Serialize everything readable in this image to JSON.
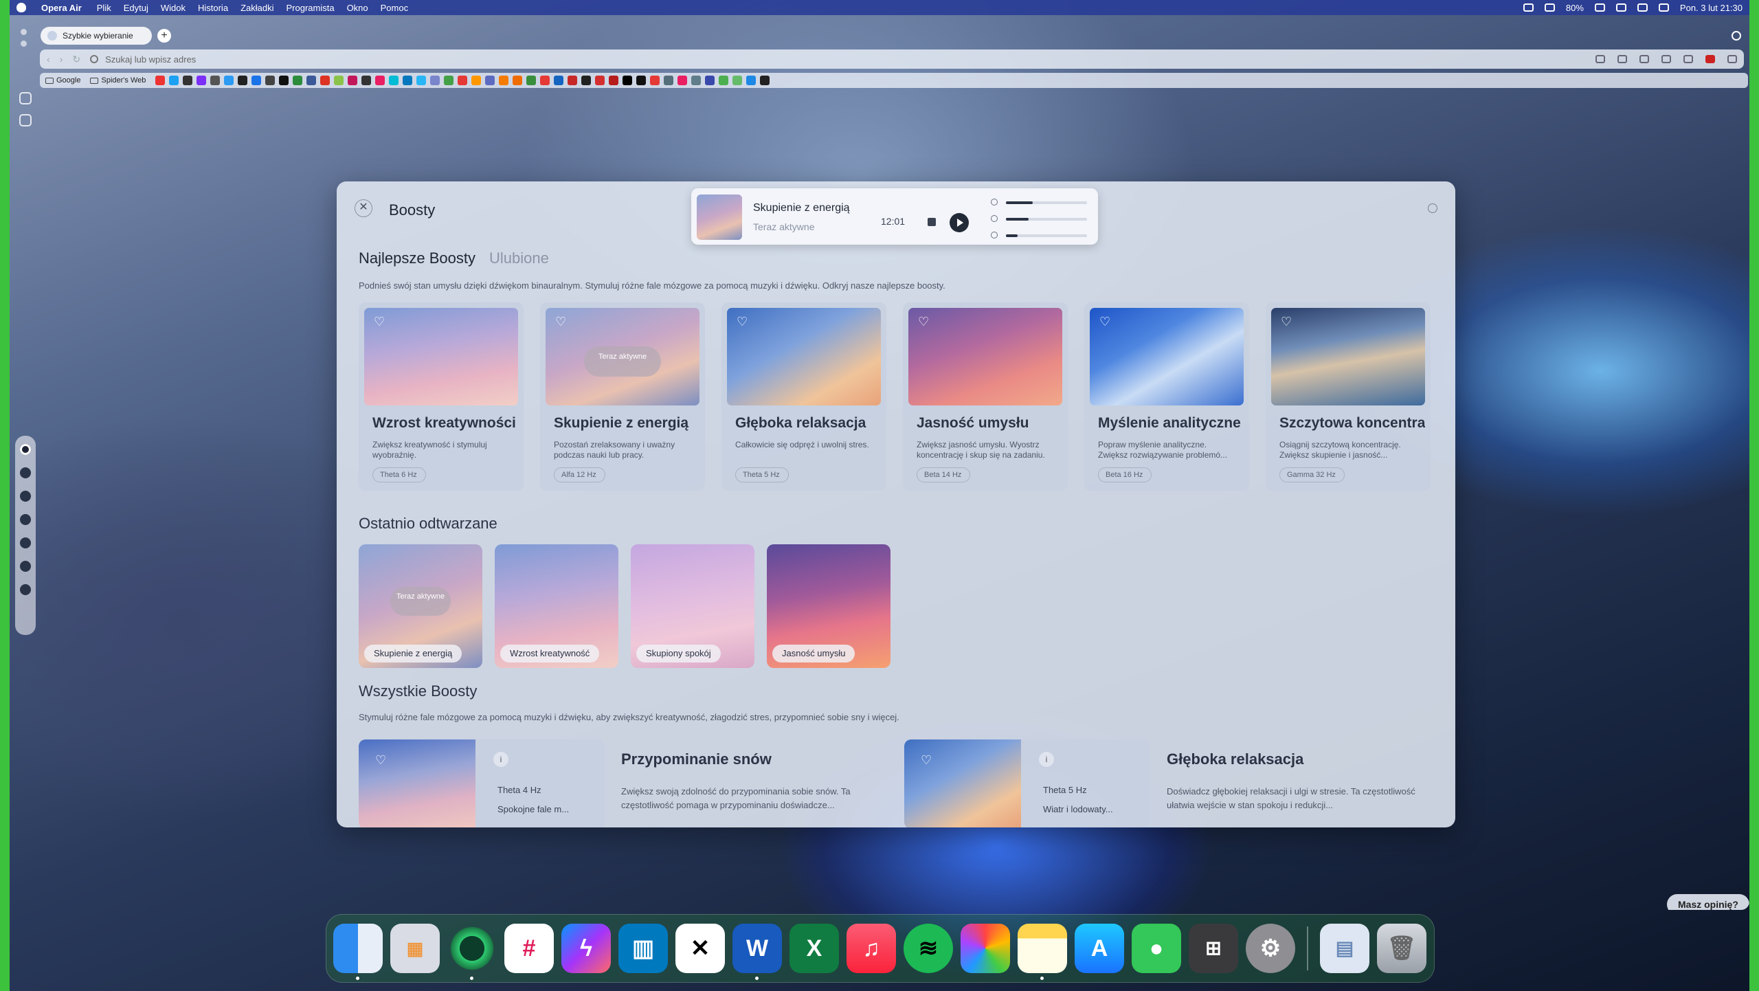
{
  "menubar": {
    "app_name": "Opera Air",
    "items": [
      "Plik",
      "Edytuj",
      "Widok",
      "Historia",
      "Zakładki",
      "Programista",
      "Okno",
      "Pomoc"
    ],
    "battery": "80%",
    "datetime": "Pon. 3 lut 21:30"
  },
  "browser": {
    "tab_title": "Szybkie wybieranie",
    "address_placeholder": "Szukaj lub wpisz adres",
    "bookmarks": [
      "Google",
      "Spider's Web"
    ]
  },
  "boosty": {
    "title": "Boosty",
    "player": {
      "title": "Skupienie z energią",
      "status": "Teraz aktywne",
      "time": "12:01",
      "sliders": [
        0.33,
        0.28,
        0.14
      ]
    },
    "tabs": {
      "top": "Najlepsze Boosty",
      "favorites": "Ulubione"
    },
    "top_description": "Podnieś swój stan umysłu dzięki dźwiękom binauralnym. Stymuluj różne fale mózgowe za pomocą muzyki i dźwięku. Odkryj nasze najlepsze boosty.",
    "active_badge": "Teraz aktywne",
    "top_cards": [
      {
        "title": "Wzrost kreatywności",
        "desc": "Zwiększ kreatywność i stymuluj wyobraźnię.",
        "freq": "Theta 6 Hz"
      },
      {
        "title": "Skupienie z energią",
        "desc": "Pozostań zrelaksowany i uważny podczas nauki lub pracy.",
        "freq": "Alfa 12 Hz"
      },
      {
        "title": "Głęboka relaksacja",
        "desc": "Całkowicie się odpręż i uwolnij stres.",
        "freq": "Theta 5 Hz"
      },
      {
        "title": "Jasność umysłu",
        "desc": "Zwiększ jasność umysłu. Wyostrz koncentrację i skup się na zadaniu.",
        "freq": "Beta 14 Hz"
      },
      {
        "title": "Myślenie analityczne",
        "desc": "Popraw myślenie analityczne. Zwiększ rozwiązywanie problemó...",
        "freq": "Beta 16 Hz"
      },
      {
        "title": "Szczytowa koncentracja",
        "desc": "Osiągnij szczytową koncentrację. Zwiększ skupienie i jasność...",
        "freq": "Gamma 32 Hz"
      }
    ],
    "recent_title": "Ostatnio odtwarzane",
    "recent": [
      "Skupienie z energią",
      "Wzrost kreatywność",
      "Skupiony spokój",
      "Jasność umysłu"
    ],
    "all_title": "Wszystkie Boosty",
    "all_description": "Stymuluj różne fale mózgowe za pomocą muzyki i dźwięku, aby zwiększyć kreatywność, złagodzić stres, przypomnieć sobie sny i więcej.",
    "all_items": [
      {
        "title": "Przypominanie snów",
        "freq": "Theta 4 Hz",
        "sound": "Spokojne fale m...",
        "desc": "Zwiększ swoją zdolność do przypominania sobie snów. Ta częstotliwość pomaga w przypominaniu doświadcze..."
      },
      {
        "title": "Głęboka relaksacja",
        "freq": "Theta 5 Hz",
        "sound": "Wiatr i lodowaty...",
        "desc": "Doświadcz głębokiej relaksacji i ulgi w stresie. Ta częstotliwość ułatwia wejście w stan spokoju i redukcji..."
      }
    ]
  },
  "feedback_button": "Masz opinię?",
  "dock_apps": [
    "finder-icon",
    "launchpad-icon",
    "opera-icon",
    "slack-icon",
    "messenger-icon",
    "trello-icon",
    "capcut-icon",
    "word-icon",
    "excel-icon",
    "music-icon",
    "spotify-icon",
    "photos-icon",
    "notes-icon",
    "appstore-icon",
    "messages-icon",
    "calculator-icon",
    "settings-icon",
    "preview-icon",
    "trash-icon"
  ],
  "colors": {
    "accent": "#2a3244",
    "dock_green": "#3cc23c"
  }
}
